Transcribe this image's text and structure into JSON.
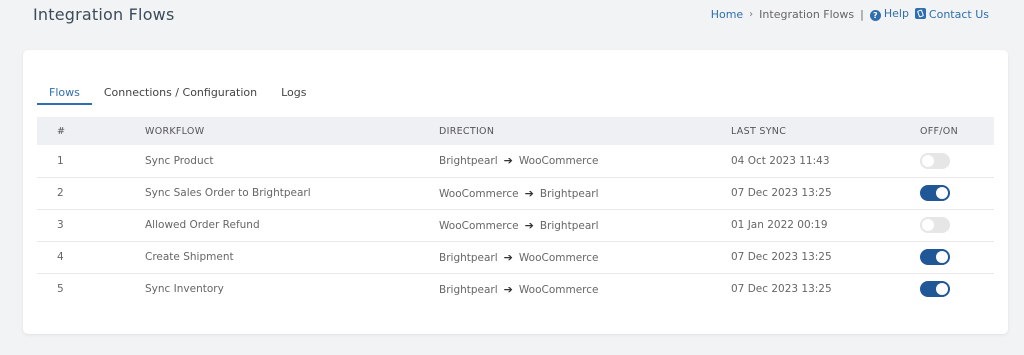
{
  "header": {
    "title": "Integration Flows",
    "breadcrumb": {
      "home": "Home",
      "current": "Integration Flows",
      "divider": "|",
      "help": "Help",
      "contact": "Contact Us"
    }
  },
  "tabs": [
    "Flows",
    "Connections / Configuration",
    "Logs"
  ],
  "table": {
    "headers": [
      "#",
      "WORKFLOW",
      "DIRECTION",
      "LAST SYNC",
      "OFF/ON"
    ],
    "rows": [
      {
        "num": "1",
        "workflow": "Sync Product",
        "from": "Brightpearl",
        "to": "WooCommerce",
        "last_sync": "04 Oct 2023 11:43",
        "enabled": false
      },
      {
        "num": "2",
        "workflow": "Sync Sales Order to Brightpearl",
        "from": "WooCommerce",
        "to": "Brightpearl",
        "last_sync": "07 Dec 2023 13:25",
        "enabled": true
      },
      {
        "num": "3",
        "workflow": "Allowed Order Refund",
        "from": "WooCommerce",
        "to": "Brightpearl",
        "last_sync": "01 Jan 2022 00:19",
        "enabled": false
      },
      {
        "num": "4",
        "workflow": "Create Shipment",
        "from": "Brightpearl",
        "to": "WooCommerce",
        "last_sync": "07 Dec 2023 13:25",
        "enabled": true
      },
      {
        "num": "5",
        "workflow": "Sync Inventory",
        "from": "Brightpearl",
        "to": "WooCommerce",
        "last_sync": "07 Dec 2023 13:25",
        "enabled": true
      }
    ]
  },
  "colors": {
    "accent": "#2f6fae",
    "toggle_on": "#1f5797",
    "toggle_off": "#e6e6e6"
  }
}
